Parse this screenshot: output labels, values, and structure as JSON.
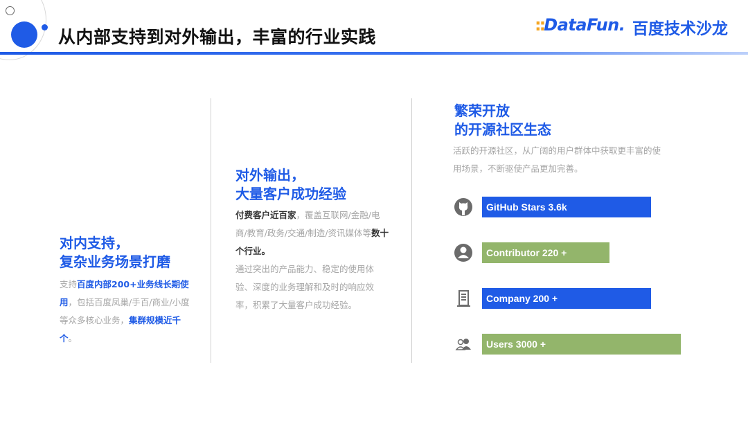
{
  "header": {
    "title": "从内部支持到对外输出，丰富的行业实践",
    "logo_datafun": "DataFun.",
    "logo_baidu": "百度技术沙龙"
  },
  "col1": {
    "heading_line1": "对内支持，",
    "heading_line2": "复杂业务场景打磨",
    "p1": "支持",
    "p1_bold": "百度内部200+业务线长期使用",
    "p2": "，包括百度凤巢/手百/商业/小度等众多核心业务，",
    "p2_bold": "集群规模近千个",
    "p3": "。"
  },
  "col2": {
    "heading_line1": "对外输出，",
    "heading_line2": "大量客户成功经验",
    "p1_bold": "付费客户近百家",
    "p1": "，覆盖互联网/金融/电商/教育/政务/交通/制造/资讯媒体等",
    "p1_bold2": "数十个行业。",
    "p2": "通过突出的产品能力、稳定的使用体验、深度的业务理解和及时的响应效率，积累了大量客户成功经验。"
  },
  "col3": {
    "heading_line1": "繁荣开放",
    "heading_line2": "的开源社区生态",
    "desc": "活跃的开源社区，从广阔的用户群体中获取更丰富的使用场景，不断驱使产品更加完善。"
  },
  "stats": [
    {
      "icon": "github-icon",
      "label": "GitHub Stars 3.6k",
      "color": "#1f5be6",
      "value": 0.85
    },
    {
      "icon": "contributor-icon",
      "label": "Contributor 220 +",
      "color": "#93b56b",
      "value": 0.64
    },
    {
      "icon": "company-icon",
      "label": "Company 200 +",
      "color": "#1f5be6",
      "value": 0.85
    },
    {
      "icon": "users-icon",
      "label": "Users 3000 +",
      "color": "#93b56b",
      "value": 1.0
    }
  ],
  "colors": {
    "accent": "#1f5be6",
    "green": "#93b56b",
    "muted_text": "#a6a6a6"
  }
}
